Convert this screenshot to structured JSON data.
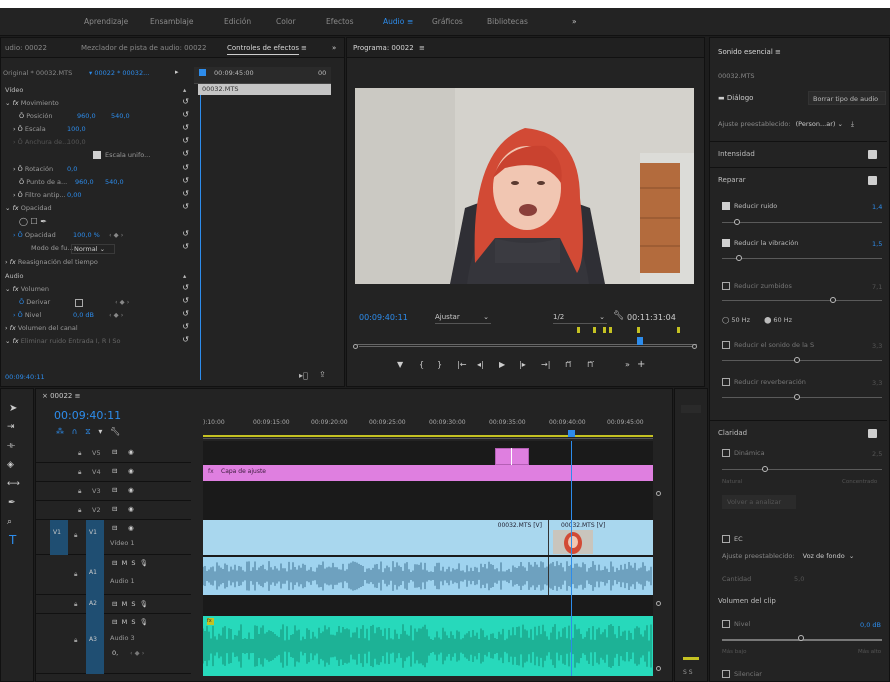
{
  "workspaces": [
    "Aprendizaje",
    "Ensamblaje",
    "Edición",
    "Color",
    "Efectos",
    "Audio",
    "Gráficos",
    "Bibliotecas"
  ],
  "workspace_active": "Audio",
  "left_tabs": [
    "udio: 00022",
    "Mezclador de pista de audio: 00022",
    "Controles de efectos"
  ],
  "ec": {
    "clip_source": "Original * 00032.MTS",
    "clip_seq": "00022 * 00032...",
    "time_top": "00:09:45:00",
    "time_edge": "00",
    "clip_name": "00032.MTS",
    "section_video": "Vídeo",
    "movimiento": "Movimiento",
    "posicion": "Posición",
    "pos_x": "960,0",
    "pos_y": "540,0",
    "escala": "Escala",
    "escala_val": "100,0",
    "anchura": "Anchura de...",
    "anchura_val": "100,0",
    "escala_unif": "Escala unifo...",
    "rotacion": "Rotación",
    "rot_val": "0,0",
    "punto": "Punto de a...",
    "punto_x": "960,0",
    "punto_y": "540,0",
    "filtro": "Filtro antip...",
    "filtro_val": "0,00",
    "opacidad": "Opacidad",
    "opacidad_lbl": "Opacidad",
    "opacidad_val": "100,0 %",
    "modo": "Modo de fu...",
    "modo_val": "Normal",
    "reasignacion": "Reasignación del tiempo",
    "section_audio": "Audio",
    "volumen": "Volumen",
    "derivar": "Derivar",
    "nivel": "Nivel",
    "nivel_val": "0,0 dB",
    "vol_canal": "Volumen del canal",
    "eliminar": "Eliminar ruido Entrada I, R I So",
    "time_bottom": "00:09:40:11"
  },
  "program": {
    "title": "Programa: 00022",
    "timecode": "00:09:40:11",
    "fit": "Ajustar",
    "quality": "1/2",
    "duration": "00:11:31:04"
  },
  "timeline": {
    "seq": "00022",
    "timecode": "00:09:40:11",
    "ruler": [
      "):10:00",
      "00:09:15:00",
      "00:09:20:00",
      "00:09:25:00",
      "00:09:30:00",
      "00:09:35:00",
      "00:09:40:00",
      "00:09:45:00"
    ],
    "tracks": [
      {
        "id": "V5",
        "name": ""
      },
      {
        "id": "V4",
        "name": ""
      },
      {
        "id": "V3",
        "name": ""
      },
      {
        "id": "V2",
        "name": ""
      },
      {
        "id": "V1",
        "name": "Vídeo 1",
        "src": "V1"
      },
      {
        "id": "A1",
        "name": "Audio 1"
      },
      {
        "id": "A2",
        "name": ""
      },
      {
        "id": "A3",
        "name": "Audio 3",
        "extra": "0,"
      }
    ],
    "adjust_clip": "Capa de ajuste",
    "clip1": "00032.MTS [V]",
    "clip2": "00032.MTS [V]"
  },
  "essential": {
    "title": "Sonido esencial",
    "clip": "00032.MTS",
    "dialog": "Diálogo",
    "clear_type": "Borrar tipo de audio",
    "preset_label": "Ajuste preestablecido:",
    "preset_val": "(Person...ar)",
    "intensidad": "Intensidad",
    "reparar": "Reparar",
    "reducir_ruido": "Reducir ruido",
    "ruido_val": "1,4",
    "reducir_vib": "Reducir la vibración",
    "vib_val": "1,5",
    "reducir_zumb": "Reducir zumbidos",
    "zumb_val": "7,1",
    "hz50": "50 Hz",
    "hz60": "60 Hz",
    "reducir_s": "Reducir el sonido de la S",
    "s_val": "3,3",
    "reducir_rev": "Reducir reverberación",
    "rev_val": "3,3",
    "claridad": "Claridad",
    "dinamica": "Dinámica",
    "din_val": "2,5",
    "natural": "Natural",
    "concentrado": "Concentrado",
    "volver": "Volver a analizar",
    "ec": "EC",
    "ec_preset_label": "Ajuste preestablecido:",
    "ec_preset_val": "Voz de fondo",
    "cantidad": "Cantidad",
    "cant_val": "5,0",
    "vol_clip": "Volumen del clip",
    "nivel": "Nivel",
    "nivel_val": "0,0 dB",
    "mas_bajo": "Más bajo",
    "mas_alto": "Más alto",
    "silenciar": "Silenciar"
  },
  "meter_label": "S S",
  "colors": {
    "accent": "#2d8ceb",
    "adjust": "#df7fe0",
    "video": "#a9d7ee",
    "audio1": "#9fd3ef",
    "audio3": "#27d9bb"
  }
}
